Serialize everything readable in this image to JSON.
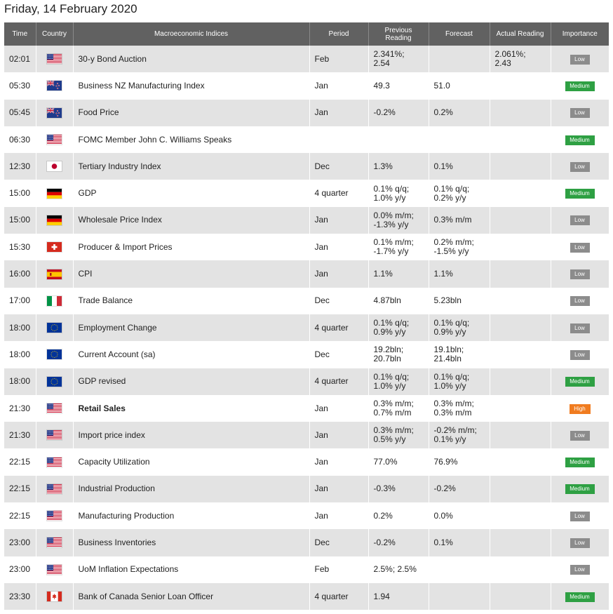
{
  "date_title": "Friday, 14 February 2020",
  "headers": {
    "time": "Time",
    "country": "Country",
    "indices": "Macroeconomic Indices",
    "period": "Period",
    "previous": "Previous Reading",
    "forecast": "Forecast",
    "actual": "Actual Reading",
    "importance": "Importance"
  },
  "rows": [
    {
      "time": "02:01",
      "flag": "us-flag-icon",
      "name": "30-y Bond Auction",
      "period": "Feb",
      "previous": [
        "2.341%;",
        "2.54"
      ],
      "forecast": [],
      "actual": [
        "2.061%;",
        "2.43"
      ],
      "importance": "Low"
    },
    {
      "time": "05:30",
      "flag": "nz-flag-icon",
      "name": "Business NZ Manufacturing Index",
      "period": "Jan",
      "previous": [
        "49.3"
      ],
      "forecast": [
        "51.0"
      ],
      "actual": [],
      "importance": "Medium"
    },
    {
      "time": "05:45",
      "flag": "nz-flag-icon",
      "name": "Food Price",
      "period": "Jan",
      "previous": [
        "-0.2%"
      ],
      "forecast": [
        "0.2%"
      ],
      "actual": [],
      "importance": "Low"
    },
    {
      "time": "06:30",
      "flag": "us-flag-icon",
      "name": "FOMC Member John C. Williams Speaks",
      "period": "",
      "previous": [],
      "forecast": [],
      "actual": [],
      "importance": "Medium"
    },
    {
      "time": "12:30",
      "flag": "jp-flag-icon",
      "name": "Tertiary Industry Index",
      "period": "Dec",
      "previous": [
        "1.3%"
      ],
      "forecast": [
        "0.1%"
      ],
      "actual": [],
      "importance": "Low"
    },
    {
      "time": "15:00",
      "flag": "de-flag-icon",
      "name": "GDP",
      "period": "4 quarter",
      "previous": [
        "0.1% q/q;",
        "1.0% y/y"
      ],
      "forecast": [
        "0.1% q/q;",
        "0.2% y/y"
      ],
      "actual": [],
      "importance": "Medium"
    },
    {
      "time": "15:00",
      "flag": "de-flag-icon",
      "name": "Wholesale Price Index",
      "period": "Jan",
      "previous": [
        "0.0% m/m;",
        "-1.3% y/y"
      ],
      "forecast": [
        "0.3% m/m"
      ],
      "actual": [],
      "importance": "Low"
    },
    {
      "time": "15:30",
      "flag": "ch-flag-icon",
      "name": "Producer & Import Prices",
      "period": "Jan",
      "previous": [
        "0.1% m/m;",
        "-1.7% y/y"
      ],
      "forecast": [
        "0.2% m/m;",
        "-1.5% y/y"
      ],
      "actual": [],
      "importance": "Low"
    },
    {
      "time": "16:00",
      "flag": "es-flag-icon",
      "name": "CPI",
      "period": "Jan",
      "previous": [
        "1.1%"
      ],
      "forecast": [
        "1.1%"
      ],
      "actual": [],
      "importance": "Low"
    },
    {
      "time": "17:00",
      "flag": "it-flag-icon",
      "name": "Trade Balance",
      "period": "Dec",
      "previous": [
        "4.87bln"
      ],
      "forecast": [
        "5.23bln"
      ],
      "actual": [],
      "importance": "Low"
    },
    {
      "time": "18:00",
      "flag": "eu-flag-icon",
      "name": "Employment Change",
      "period": "4 quarter",
      "previous": [
        "0.1% q/q;",
        "0.9% y/y"
      ],
      "forecast": [
        "0.1% q/q;",
        "0.9% y/y"
      ],
      "actual": [],
      "importance": "Low"
    },
    {
      "time": "18:00",
      "flag": "eu-flag-icon",
      "name": "Current Account (sa)",
      "period": "Dec",
      "previous": [
        "19.2bln;",
        "20.7bln"
      ],
      "forecast": [
        "19.1bln;",
        "21.4bln"
      ],
      "actual": [],
      "importance": "Low"
    },
    {
      "time": "18:00",
      "flag": "eu-flag-icon",
      "name": "GDP revised",
      "period": "4 quarter",
      "previous": [
        "0.1% q/q;",
        "1.0% y/y"
      ],
      "forecast": [
        "0.1% q/q;",
        "1.0% y/y"
      ],
      "actual": [],
      "importance": "Medium"
    },
    {
      "time": "21:30",
      "flag": "us-flag-icon",
      "name": "Retail Sales",
      "bold": true,
      "period": "Jan",
      "previous": [
        "0.3% m/m;",
        "0.7% m/m"
      ],
      "forecast": [
        "0.3% m/m;",
        "0.3% m/m"
      ],
      "actual": [],
      "importance": "High"
    },
    {
      "time": "21:30",
      "flag": "us-flag-icon",
      "name": "Import price index",
      "period": "Jan",
      "previous": [
        "0.3% m/m;",
        "0.5% y/y"
      ],
      "forecast": [
        "-0.2% m/m;",
        "0.1% y/y"
      ],
      "actual": [],
      "importance": "Low"
    },
    {
      "time": "22:15",
      "flag": "us-flag-icon",
      "name": "Capacity Utilization",
      "period": "Jan",
      "previous": [
        "77.0%"
      ],
      "forecast": [
        "76.9%"
      ],
      "actual": [],
      "importance": "Medium"
    },
    {
      "time": "22:15",
      "flag": "us-flag-icon",
      "name": "Industrial Production",
      "period": "Jan",
      "previous": [
        "-0.3%"
      ],
      "forecast": [
        "-0.2%"
      ],
      "actual": [],
      "importance": "Medium"
    },
    {
      "time": "22:15",
      "flag": "us-flag-icon",
      "name": "Manufacturing Production",
      "period": "Jan",
      "previous": [
        "0.2%"
      ],
      "forecast": [
        "0.0%"
      ],
      "actual": [],
      "importance": "Low"
    },
    {
      "time": "23:00",
      "flag": "us-flag-icon",
      "name": "Business Inventories",
      "period": "Dec",
      "previous": [
        "-0.2%"
      ],
      "forecast": [
        "0.1%"
      ],
      "actual": [],
      "importance": "Low"
    },
    {
      "time": "23:00",
      "flag": "us-flag-icon",
      "name": "UoM Inflation Expectations",
      "period": "Feb",
      "previous": [
        "2.5%; 2.5%"
      ],
      "forecast": [],
      "actual": [],
      "importance": "Low"
    },
    {
      "time": "23:30",
      "flag": "ca-flag-icon",
      "name": "Bank of Canada Senior Loan Officer",
      "period": "4 quarter",
      "previous": [
        "1.94"
      ],
      "forecast": [],
      "actual": [],
      "importance": "Medium"
    }
  ],
  "colors": {
    "header_bg": "#616161",
    "row_alt": "#e3e3e3",
    "low": "#8c8c8c",
    "medium": "#2ea043",
    "high": "#f07c20"
  }
}
